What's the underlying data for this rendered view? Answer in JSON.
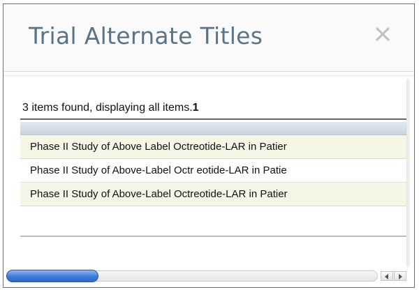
{
  "dialog": {
    "title": "Trial Alternate Titles",
    "close_icon": "close-icon"
  },
  "results": {
    "status_text": "3 items found, displaying all items.",
    "page_number": "1"
  },
  "rows": [
    "Phase II Study of Above Label Octreotide-LAR in Patier",
    "Phase II Study of Above-Label Octr eotide-LAR in Patie",
    "Phase II Study of Above-Label Octreotide-LAR in Patier"
  ],
  "scrollbar": {
    "left_arrow_icon": "arrow-left-icon",
    "right_arrow_icon": "arrow-right-icon"
  },
  "colors": {
    "title": "#5b7386",
    "odd_row": "#f4f6e6",
    "scroll_thumb": "#3d7ad8"
  }
}
